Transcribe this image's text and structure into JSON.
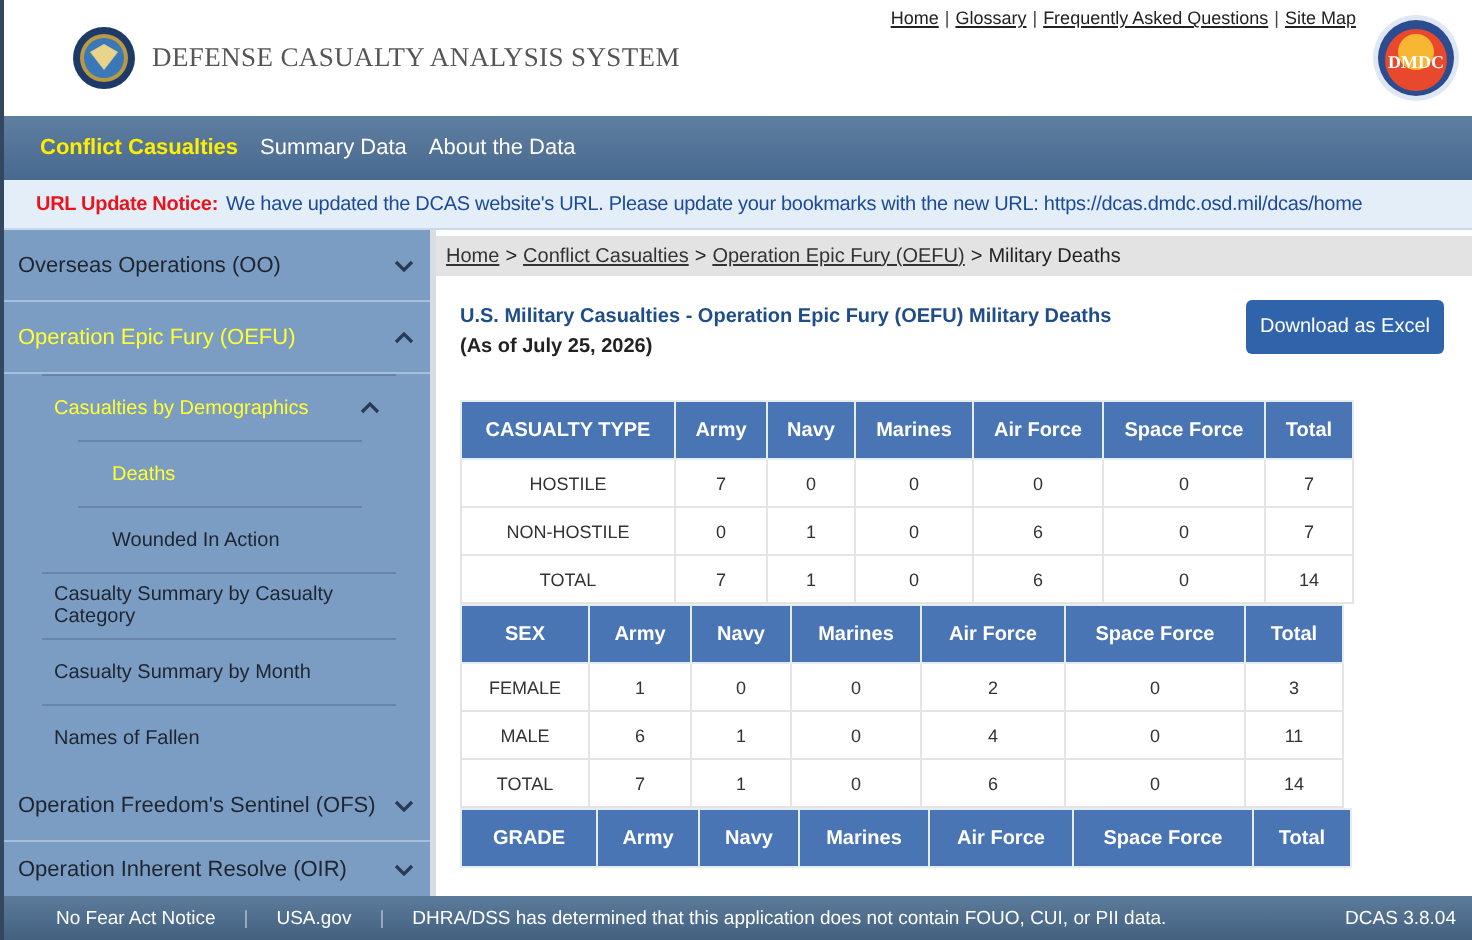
{
  "header": {
    "title": "DEFENSE CASUALTY ANALYSIS SYSTEM",
    "links": [
      "Home",
      "Glossary",
      "Frequently Asked Questions",
      "Site Map"
    ],
    "separator": "|",
    "badge_text": "DMDC"
  },
  "nav": [
    {
      "label": "Conflict Casualties",
      "selected": true
    },
    {
      "label": "Summary Data",
      "selected": false
    },
    {
      "label": "About the Data",
      "selected": false
    }
  ],
  "notice": {
    "label": "URL Update Notice:",
    "text": "We have updated the DCAS website's URL. Please update your bookmarks with the new URL: https://dcas.dmdc.osd.mil/dcas/home"
  },
  "sidebar": [
    {
      "label": "Overseas Operations (OO)",
      "selected": false,
      "expanded": false
    },
    {
      "label": "Operation Epic Fury (OEFU)",
      "selected": true,
      "expanded": true,
      "children": [
        {
          "label": "Casualties by Demographics",
          "selected": true,
          "expanded": true,
          "children": [
            {
              "label": "Deaths",
              "selected": true
            },
            {
              "label": "Wounded In Action",
              "selected": false
            }
          ]
        },
        {
          "label": "Casualty Summary by Casualty Category",
          "selected": false
        },
        {
          "label": "Casualty Summary by Month",
          "selected": false
        },
        {
          "label": "Names of Fallen",
          "selected": false
        }
      ]
    },
    {
      "label": "Operation Freedom's Sentinel (OFS)",
      "selected": false,
      "expanded": false
    },
    {
      "label": "Operation Inherent Resolve (OIR)",
      "selected": false,
      "expanded": false
    }
  ],
  "breadcrumb": {
    "links": [
      "Home",
      "Conflict Casualties",
      "Operation Epic Fury (OEFU)"
    ],
    "current": "Military Deaths",
    "separator": ">"
  },
  "title": "U.S. Military Casualties - Operation Epic Fury (OEFU) Military Deaths",
  "subtitle": "(As of July 25, 2026)",
  "download_button": "Download as Excel",
  "tables": [
    {
      "columns": [
        "CASUALTY TYPE",
        "Army",
        "Navy",
        "Marines",
        "Air Force",
        "Space Force",
        "Total"
      ],
      "rows": [
        [
          "HOSTILE",
          "7",
          "0",
          "0",
          "0",
          "0",
          "7"
        ],
        [
          "NON-HOSTILE",
          "0",
          "1",
          "0",
          "6",
          "0",
          "7"
        ],
        [
          "TOTAL",
          "7",
          "1",
          "0",
          "6",
          "0",
          "14"
        ]
      ]
    },
    {
      "columns": [
        "SEX",
        "Army",
        "Navy",
        "Marines",
        "Air Force",
        "Space Force",
        "Total"
      ],
      "rows": [
        [
          "FEMALE",
          "1",
          "0",
          "0",
          "2",
          "0",
          "3"
        ],
        [
          "MALE",
          "6",
          "1",
          "0",
          "4",
          "0",
          "11"
        ],
        [
          "TOTAL",
          "7",
          "1",
          "0",
          "6",
          "0",
          "14"
        ]
      ]
    },
    {
      "columns": [
        "GRADE",
        "Army",
        "Navy",
        "Marines",
        "Air Force",
        "Space Force",
        "Total"
      ]
    }
  ],
  "footer": {
    "links": [
      "No Fear Act Notice",
      "USA.gov"
    ],
    "separator": "|",
    "text": "DHRA/DSS has determined that this application does not contain FOUO, CUI, or PII data.",
    "version": "DCAS 3.8.04"
  }
}
